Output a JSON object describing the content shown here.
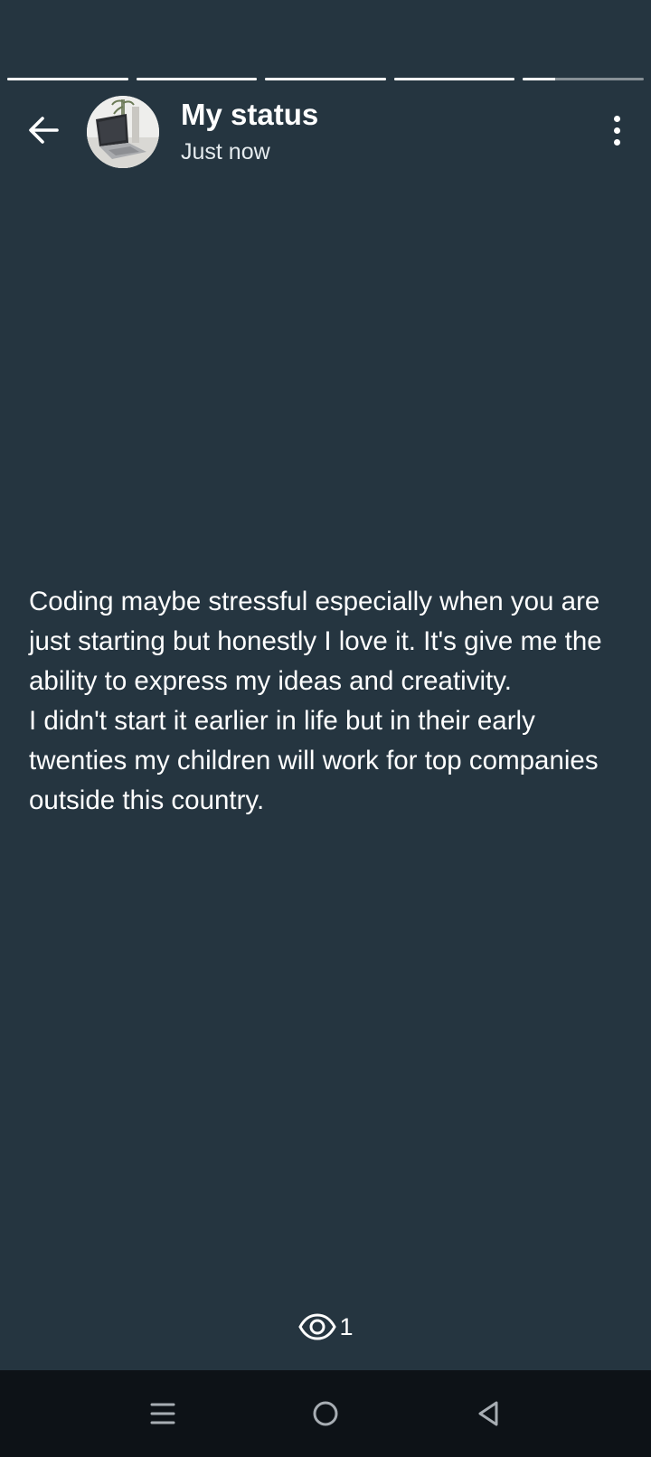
{
  "status": {
    "progress_segments": [
      1,
      1,
      1,
      1,
      0.27
    ],
    "title": "My status",
    "timestamp": "Just now",
    "text_lines": [
      "Coding maybe stressful especially when you are just starting but honestly I love it. It's give me the ability to express my ideas and creativity.",
      "I didn't start it earlier in life but in their early twenties my children will work for top companies outside this country."
    ],
    "views_count": "1"
  },
  "icons": {
    "back": "arrow-left-icon",
    "menu": "more-vertical-icon",
    "views": "eye-icon",
    "nav_recents": "menu-lines-icon",
    "nav_home": "circle-icon",
    "nav_back": "triangle-back-icon"
  },
  "colors": {
    "background": "#253540",
    "navbar": "#0d1217",
    "text": "#ffffff"
  }
}
